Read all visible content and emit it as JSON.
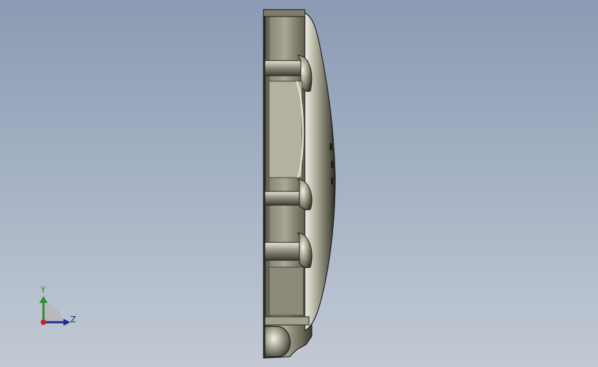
{
  "viewport": {
    "background_top": "#8a9bb3",
    "background_bottom": "#c2c9d4",
    "model": {
      "type": "3d-part-side-view",
      "color": "#6e6b5a"
    },
    "triad": {
      "y_label": "Y",
      "z_label": "Z",
      "y_color": "#2e8b2e",
      "z_color": "#1a2a8c",
      "x_color": "#cc2020"
    }
  }
}
